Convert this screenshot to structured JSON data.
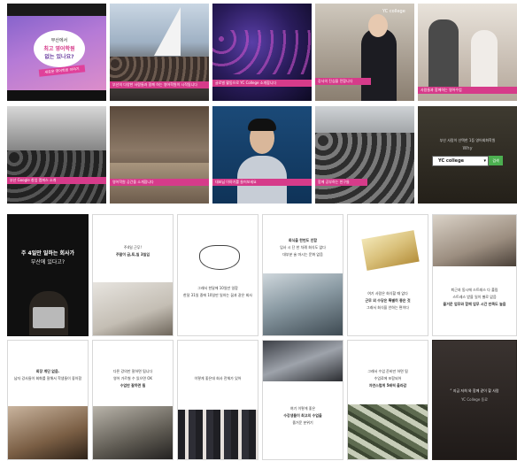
{
  "row1": {
    "tile1": {
      "line1": "부산에서",
      "line2": "최고 영어학원",
      "line3": "없는 있나요?",
      "ribbon": "새로운 영어학원 이야기"
    },
    "tile2": {
      "caption": "부산의 다양한 사람들과 함께 하는 영어학원이 시작됩니다"
    },
    "tile3": {
      "caption": "글로벌 활동으로 YC College 소개합니다"
    },
    "tile4": {
      "caption": "YC college",
      "bar": "강사의 진심을 전합니다"
    },
    "tile5": {
      "caption": "사람들과 함께하는 영어수업"
    }
  },
  "row2": {
    "tile1": {
      "caption": "부산 Google 창업 캠퍼스 소개"
    },
    "tile2": {
      "caption": "영어학원 공간을 소개합니다"
    },
    "tile3": {
      "caption": "대표님 이야기를 들어보세요"
    },
    "tile4": {
      "caption": "함께 공부하는 친구들"
    },
    "tile5": {
      "line1": "부산 사람이 선택한 1등 영어회화학원",
      "line2": "Why",
      "select_value": "YC college",
      "button": "검색"
    }
  },
  "cards_row1": [
    {
      "title": "주 4일만 일하는 회사가",
      "subtitle": "부산에 있다고?"
    },
    {
      "line1": "주4일 근무!",
      "line2": "주말이 금,토,일 3일입",
      "photo": "notebook"
    },
    {
      "line1": "그래서 한달에 10일만 일함",
      "line2": "한달 31일 중에 10일만 일하는 꿈과 같은 회사",
      "highlight": "꿈과 같은 회사"
    },
    {
      "line1": "회식을 한번도 안함",
      "line2": "입사 시 단 한 차례 회식도 없다",
      "line3": "대부분 술 마시는 문화 없음"
    },
    {
      "line1": "여기 사람은 회식할 때 없다",
      "line2": "근무 외 수당은 특별히 좋은 것",
      "line3": "그래서 회식을 안하는 편이다",
      "highlight": "근무 외 수당"
    },
    {
      "line1": "퇴근과 동시에 스트레스 다 풀림",
      "line2": "스트레스 받을 일이 별로 없음",
      "line3": "즐거운 업무와 함께 업무 시간 만족도 높음",
      "highlight": "즐거운 업무와 함께"
    }
  ],
  "cards_row2": [
    {
      "line1": "회장 계단 없음.",
      "line2": "남자 강사들이 회화를 잘해서 학생들이 좋아함"
    },
    {
      "line1": "다른 강의만 잘하면 됩니다",
      "line2": "영어 가르칠 수 있으면 OK",
      "line3": "수업만 잘하면 됨"
    },
    {
      "line1": "이렇게 좋은데 회사 전체가 있어"
    },
    {
      "line1": "여기 이렇게 좋은",
      "line2": "수강생들이 최고의 수업을",
      "line3": "즐거운 분위기",
      "highlight": "수강생들이 최고의 수업을"
    },
    {
      "line1": "그래서 수업 준비만 하면 됨",
      "line2": "수업료에 포함되어",
      "line3": "자연스럽게 5배씩 올라감",
      "highlight": "자연스럽게 5배씩"
    },
    {
      "line1": "“ 지금 저희 와 함께 같이 할 사람",
      "line2": "YC College 동료",
      "highlight": "저희 와 함께"
    }
  ]
}
